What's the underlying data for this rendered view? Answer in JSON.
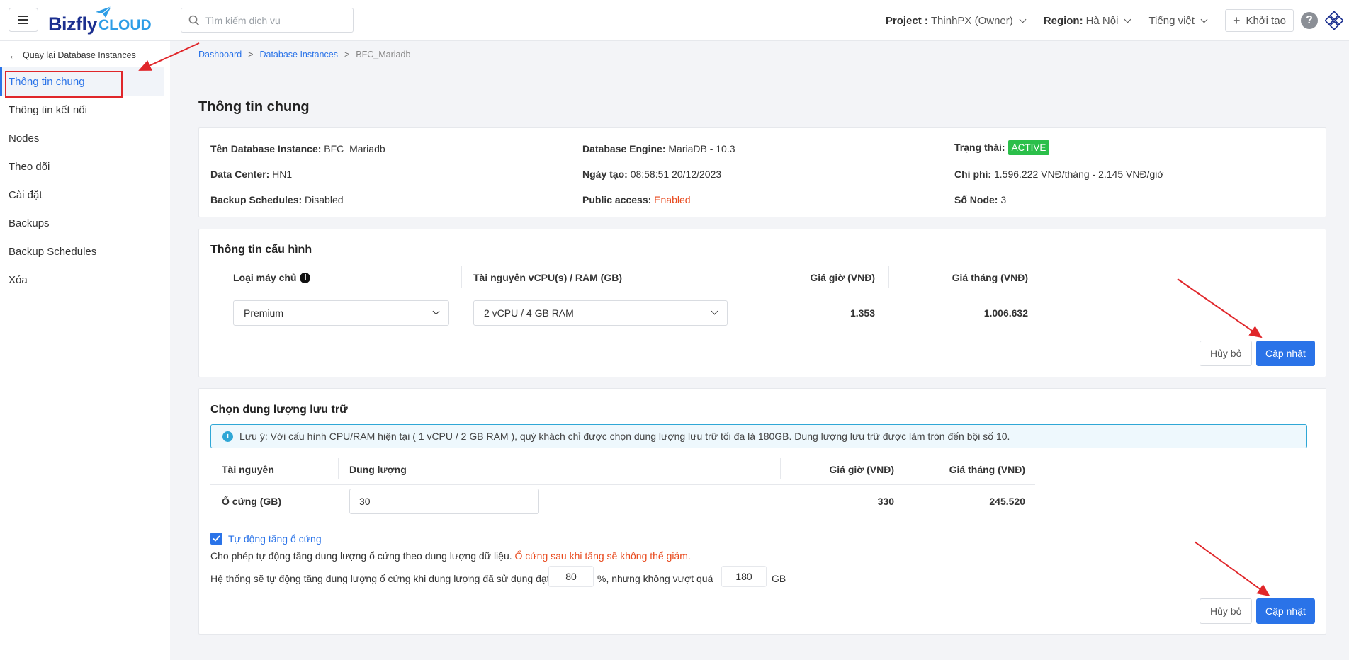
{
  "header": {
    "logo_text": "Bizfly",
    "logo_suffix": "CLOUD",
    "search_placeholder": "Tìm kiếm dịch vụ",
    "project_label": "Project :",
    "project_value": "ThinhPX (Owner)",
    "region_label": "Region:",
    "region_value": "Hà Nội",
    "language": "Tiếng việt",
    "create_label": "Khởi tạo",
    "help": "?"
  },
  "sidebar": {
    "back_label": "Quay lại Database Instances",
    "items": [
      {
        "label": "Thông tin chung"
      },
      {
        "label": "Thông tin kết nối"
      },
      {
        "label": "Nodes"
      },
      {
        "label": "Theo dõi"
      },
      {
        "label": "Cài đặt"
      },
      {
        "label": "Backups"
      },
      {
        "label": "Backup Schedules"
      },
      {
        "label": "Xóa"
      }
    ]
  },
  "breadcrumb": {
    "items": [
      "Dashboard",
      "Database Instances",
      "BFC_Mariadb"
    ],
    "separator": ">"
  },
  "general": {
    "title": "Thông tin chung",
    "instance_name_label": "Tên Database Instance:",
    "instance_name": "BFC_Mariadb",
    "data_center_label": "Data Center:",
    "data_center": "HN1",
    "backup_schedules_label": "Backup Schedules:",
    "backup_schedules": "Disabled",
    "engine_label": "Database Engine:",
    "engine": "MariaDB - 10.3",
    "created_label": "Ngày tạo:",
    "created": "08:58:51 20/12/2023",
    "public_access_label": "Public access:",
    "public_access": "Enabled",
    "status_label": "Trạng thái:",
    "status": "ACTIVE",
    "cost_label": "Chi phí:",
    "cost": "1.596.222 VNĐ/tháng - 2.145 VNĐ/giờ",
    "nodes_label": "Số Node:",
    "nodes": "3"
  },
  "config": {
    "title": "Thông tin cấu hình",
    "col_type": "Loại máy chủ",
    "col_resource": "Tài nguyên vCPU(s) / RAM (GB)",
    "col_hourly": "Giá giờ (VNĐ)",
    "col_monthly": "Giá tháng (VNĐ)",
    "type_value": "Premium",
    "resource_value": "2 vCPU / 4 GB RAM",
    "hourly": "1.353",
    "monthly": "1.006.632",
    "cancel": "Hủy bỏ",
    "update": "Cập nhật"
  },
  "storage": {
    "title": "Chọn dung lượng lưu trữ",
    "note": "Lưu ý: Với cấu hình CPU/RAM hiện tại ( 1 vCPU / 2 GB RAM ), quý khách chỉ được chọn dung lượng lưu trữ tối đa là 180GB. Dung lượng lưu trữ được làm tròn đến bội số 10.",
    "col_resource": "Tài nguyên",
    "col_capacity": "Dung lượng",
    "col_hourly": "Giá giờ (VNĐ)",
    "col_monthly": "Giá tháng (VNĐ)",
    "row_label": "Ổ cứng (GB)",
    "capacity": "30",
    "hourly": "330",
    "monthly": "245.520",
    "auto_label": "Tự động tăng ổ cứng",
    "auto_desc": "Cho phép tự động tăng dung lượng ổ cứng theo dung lượng dữ liệu.",
    "auto_warn": "Ổ cứng sau khi tăng sẽ không thể giảm.",
    "threshold_prefix": "Hệ thống sẽ tự động tăng dung lượng ổ cứng khi dung lượng đã sử dụng đạt",
    "threshold_value": "80",
    "threshold_middle": "%, nhưng không vượt quá",
    "max_value": "180",
    "max_unit": "GB",
    "cancel": "Hủy bỏ",
    "update": "Cập nhật"
  },
  "colors": {
    "primary": "#2a73e8",
    "active_badge": "#2bbf4a",
    "warning": "#e8491d",
    "annotation": "#e0262a"
  }
}
